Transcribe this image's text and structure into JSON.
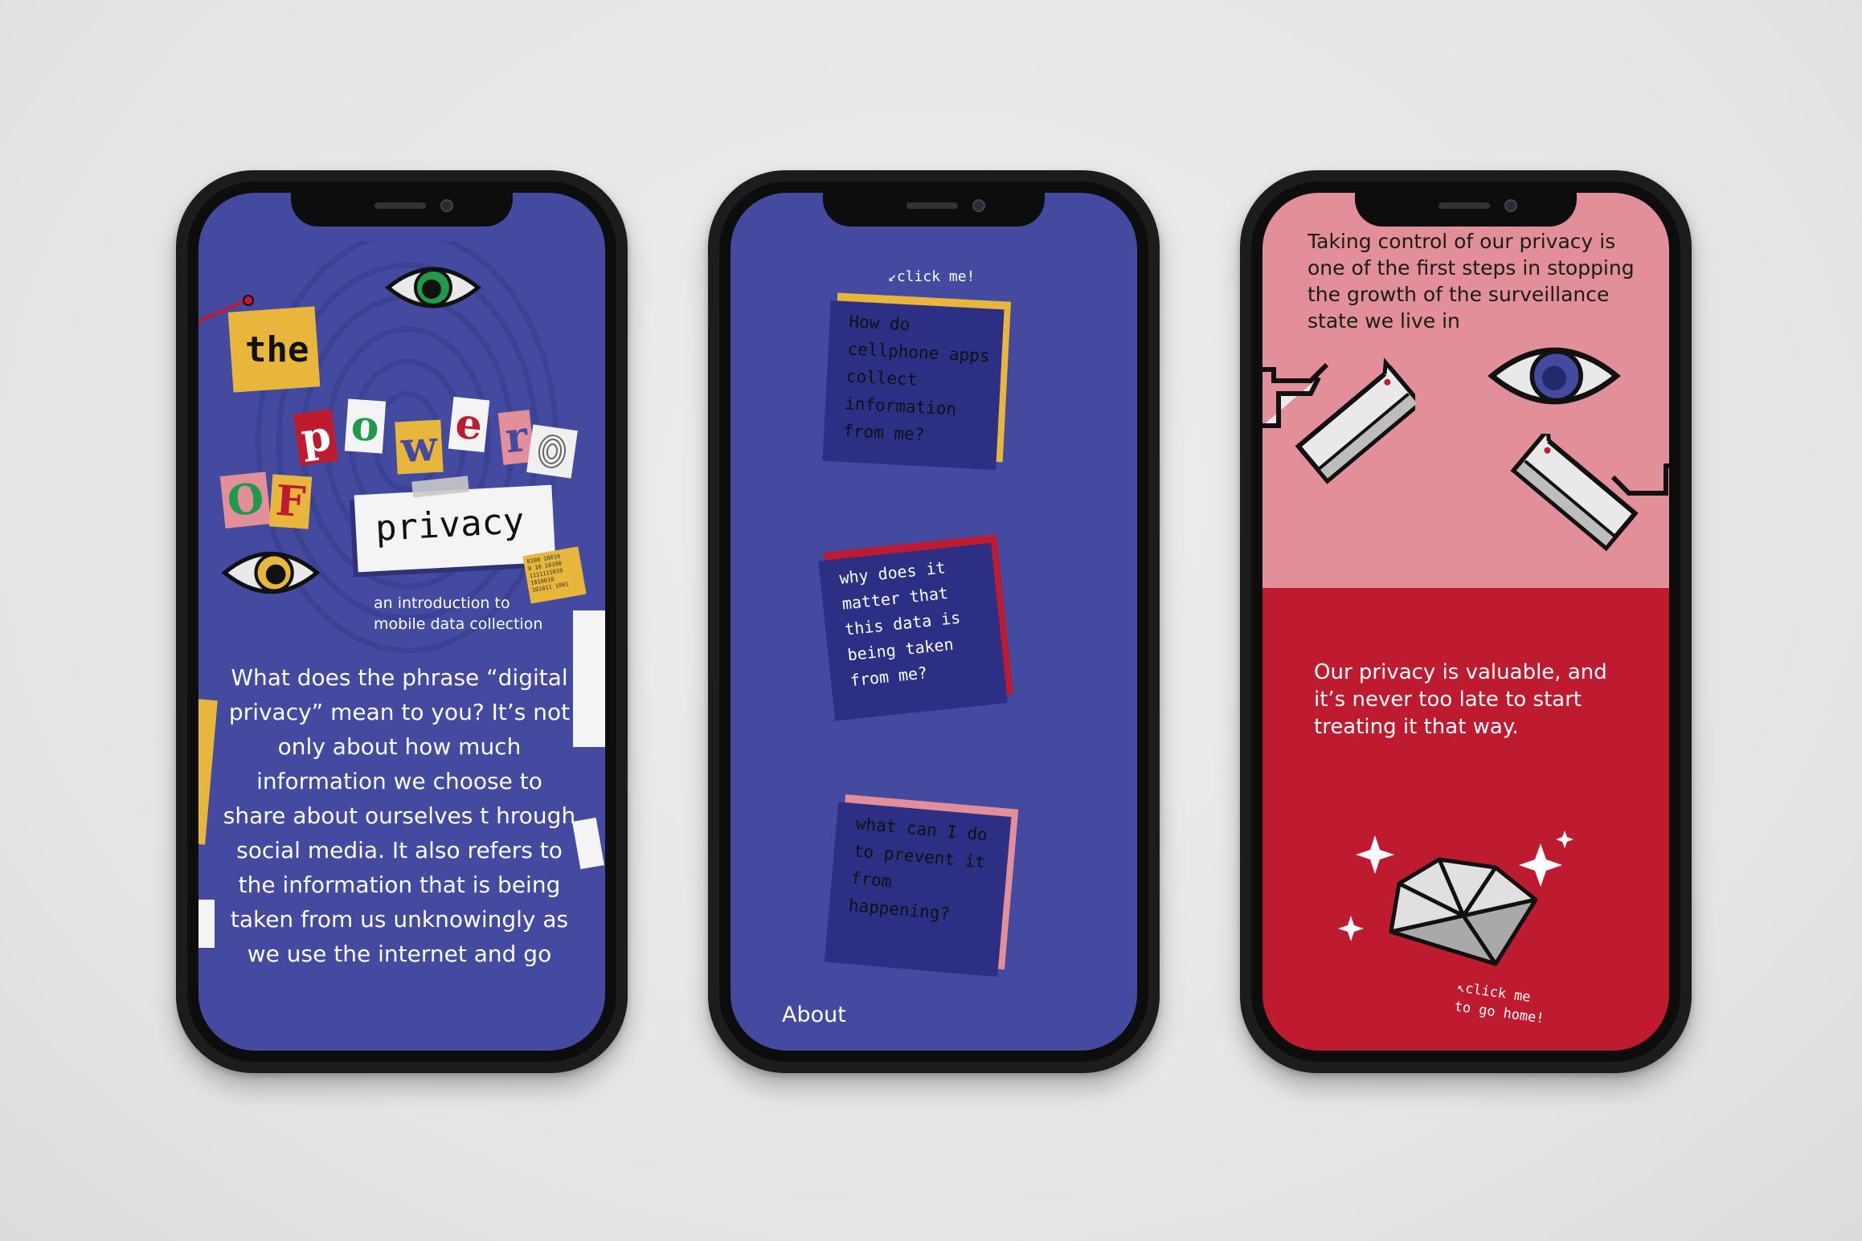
{
  "phone1": {
    "title_the": "the",
    "title_power": [
      "p",
      "o",
      "w",
      "e",
      "r"
    ],
    "title_of": [
      "O",
      "F"
    ],
    "title_privacy": "privacy",
    "binary_chip": "0100 10010\n0 10 10100\n1111111010\n1010010\n101011 1001",
    "subtitle_line1": "an introduction to",
    "subtitle_line2": "mobile data collection",
    "body": "What does the phrase “digital privacy” mean to you? It’s not only about how much information we choose to share about ourselves t hrough social media. It also refers to the information that is being taken from us unknowingly as we use the internet and go"
  },
  "phone2": {
    "click_hint": "click me!",
    "notes": [
      {
        "text": "How do cellphone apps collect information from me?",
        "color": "#e8b63a",
        "text_color": "#111111"
      },
      {
        "text": "why does it matter that this data is being taken from me?",
        "color": "#be1b30",
        "text_color": "#ffffff"
      },
      {
        "text": "what can I do to prevent it from happening?",
        "color": "#e38f9a",
        "text_color": "#111111"
      }
    ],
    "about_label": "About"
  },
  "phone3": {
    "top_text": "Taking control of our privacy is one of the first steps in stopping the growth of the surveillance state we live in",
    "quote": "Our privacy is valuable, and it’s never too late to start treating it that way.",
    "click_home_line1": "click me",
    "click_home_line2": "to go home!"
  },
  "colors": {
    "blue": "#434a9f",
    "yellow": "#e8b63a",
    "red": "#be1b30",
    "pink": "#e38f9a"
  }
}
